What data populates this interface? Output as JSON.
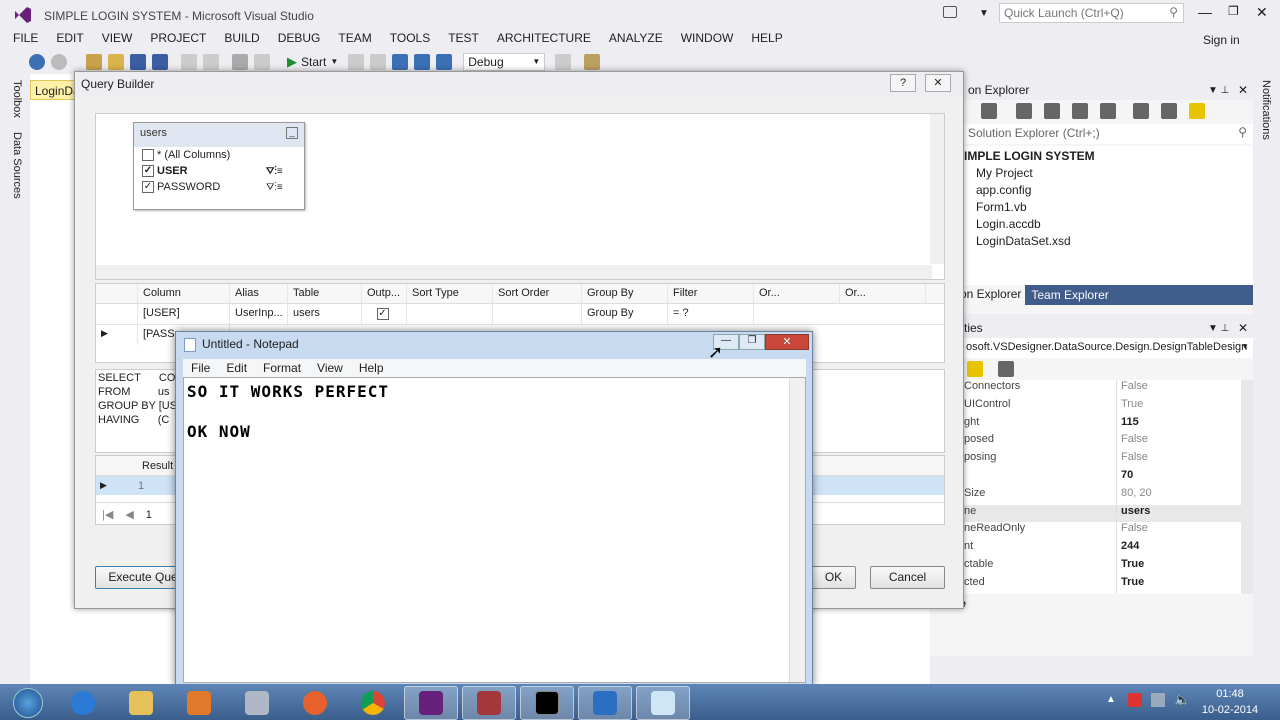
{
  "window_title": "SIMPLE LOGIN SYSTEM - Microsoft Visual Studio",
  "quick_launch_placeholder": "Quick Launch (Ctrl+Q)",
  "sign_in": "Sign in",
  "menu": [
    "FILE",
    "EDIT",
    "VIEW",
    "PROJECT",
    "BUILD",
    "DEBUG",
    "TEAM",
    "TOOLS",
    "TEST",
    "ARCHITECTURE",
    "ANALYZE",
    "WINDOW",
    "HELP"
  ],
  "toolbar": {
    "start_label": "Start",
    "config": "Debug"
  },
  "left_strip": [
    "Toolbox",
    "Data Sources"
  ],
  "right_strip": [
    "Notifications"
  ],
  "doc_tab": "LoginDa",
  "solution_explorer": {
    "title": "on Explorer",
    "search_placeholder": "Solution Explorer (Ctrl+;)",
    "root": "IMPLE LOGIN SYSTEM",
    "items": [
      "My Project",
      "app.config",
      "Form1.vb",
      "Login.accdb",
      "LoginDataSet.xsd"
    ],
    "tabs": [
      "on Explorer",
      "Team Explorer"
    ]
  },
  "properties": {
    "title": "ties",
    "object": "osoft.VSDesigner.DataSource.Design.DesignTableDesign",
    "rows": [
      {
        "name": "Connectors",
        "value": "False",
        "bold": false
      },
      {
        "name": "UIControl",
        "value": "True",
        "bold": false
      },
      {
        "name": "ght",
        "value": "115",
        "bold": true
      },
      {
        "name": "posed",
        "value": "False",
        "bold": false
      },
      {
        "name": "posing",
        "value": "False",
        "bold": false
      },
      {
        "name": "",
        "value": "70",
        "bold": true
      },
      {
        "name": "Size",
        "value": "80, 20",
        "bold": false
      },
      {
        "name": "ne",
        "value": "users",
        "bold": true
      },
      {
        "name": "neReadOnly",
        "value": "False",
        "bold": false
      },
      {
        "name": "nt",
        "value": "244",
        "bold": true
      },
      {
        "name": "ctable",
        "value": "True",
        "bold": true
      },
      {
        "name": "cted",
        "value": "True",
        "bold": true
      }
    ],
    "footer": "Name"
  },
  "query_builder": {
    "title": "Query Builder",
    "help_btn": "?",
    "close_btn": "✕",
    "table": {
      "name": "users",
      "columns": [
        {
          "label": "* (All Columns)",
          "checked": false,
          "bold": false
        },
        {
          "label": "USER",
          "checked": true,
          "bold": true
        },
        {
          "label": "PASSWORD",
          "checked": true,
          "bold": false
        }
      ]
    },
    "grid_headers": [
      "Column",
      "Alias",
      "Table",
      "Outp...",
      "Sort Type",
      "Sort Order",
      "Group By",
      "Filter",
      "Or...",
      "Or..."
    ],
    "grid_rows": [
      [
        "[USER]",
        "UserInp...",
        "users",
        "✓",
        "",
        "",
        "Group By",
        "= ?",
        "",
        ""
      ],
      [
        "[PASS",
        "",
        "",
        "",
        "",
        "",
        "",
        "",
        "",
        ""
      ]
    ],
    "sql_lines": [
      "SELECT      CO",
      "FROM         us",
      "GROUP BY [USE",
      "HAVING      (C"
    ],
    "results_header": "Result",
    "results_row": "1",
    "page_nav": "1",
    "execute_btn": "Execute Quer",
    "ok_btn": "OK",
    "cancel_btn": "Cancel"
  },
  "notepad": {
    "title": "Untitled - Notepad",
    "menu": [
      "File",
      "Edit",
      "Format",
      "View",
      "Help"
    ],
    "lines": [
      "SO IT WORKS PERFECT",
      "OK NOW"
    ]
  },
  "taskbar": {
    "time": "01:48",
    "date": "10-02-2014",
    "apps": [
      "ie-icon",
      "explorer-icon",
      "media-icon",
      "paint-icon",
      "firefox-icon",
      "chrome-icon",
      "visual-studio-icon",
      "access-icon",
      "cmd-icon",
      "app-icon",
      "notepad-icon"
    ]
  },
  "colors": {
    "vs_purple": "#68217a",
    "doc_tab": "#fff1a8",
    "taskbar": "#3b5e8c"
  }
}
